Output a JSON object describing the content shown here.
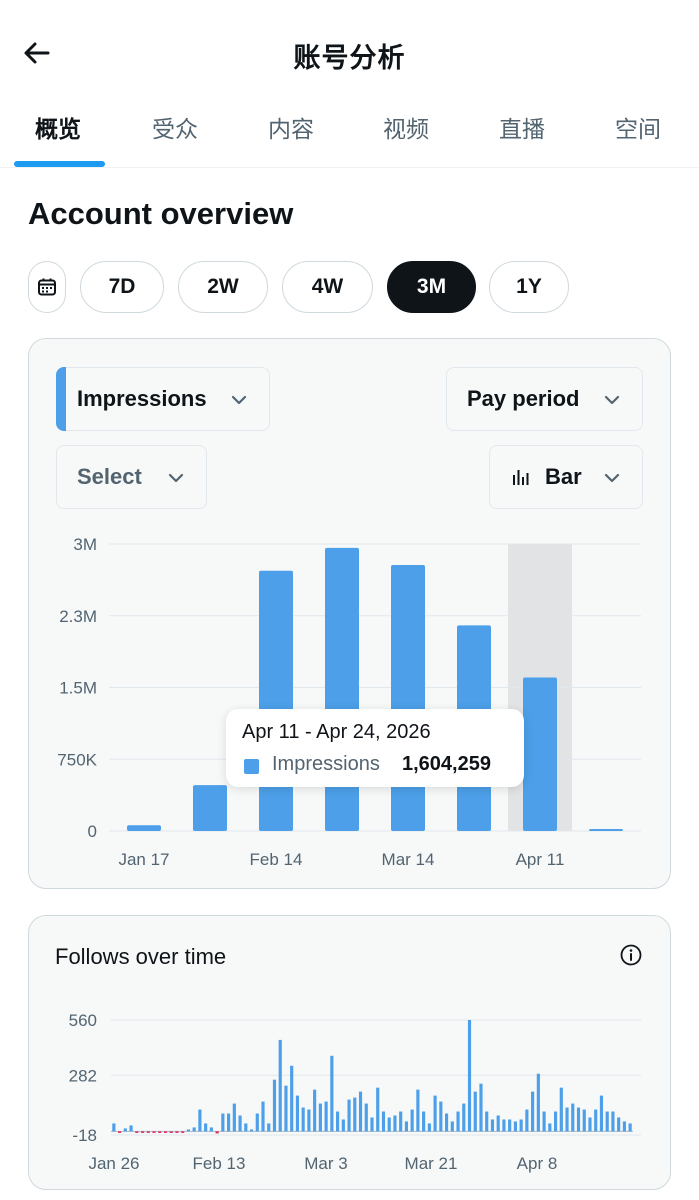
{
  "header": {
    "title": "账号分析"
  },
  "tabs": [
    {
      "label": "概览",
      "active": true
    },
    {
      "label": "受众",
      "active": false
    },
    {
      "label": "内容",
      "active": false
    },
    {
      "label": "视频",
      "active": false
    },
    {
      "label": "直播",
      "active": false
    },
    {
      "label": "空间",
      "active": false
    }
  ],
  "overview": {
    "title": "Account overview",
    "ranges": [
      {
        "label": "7D",
        "selected": false
      },
      {
        "label": "2W",
        "selected": false
      },
      {
        "label": "4W",
        "selected": false
      },
      {
        "label": "3M",
        "selected": true
      },
      {
        "label": "1Y",
        "selected": false
      }
    ],
    "metric_label": "Impressions",
    "period_label": "Pay period",
    "compare_label": "Select",
    "chart_type_label": "Bar"
  },
  "tooltip": {
    "date": "Apr 11 - Apr 24, 2026",
    "label": "Impressions",
    "value": "1,604,259"
  },
  "follows": {
    "title": "Follows over time"
  },
  "colors": {
    "accent": "#1d9bf0",
    "bar": "#4c9fe8",
    "negative": "#e0245e",
    "selected_chip": "#0f1419"
  },
  "icons": [
    "back-arrow-icon",
    "calendar-icon",
    "chevron-down-icon",
    "bar-chart-icon",
    "info-icon"
  ],
  "chart_data": [
    {
      "type": "bar",
      "series": [
        {
          "name": "Impressions",
          "values": [
            60000,
            480000,
            2720000,
            2960000,
            2780000,
            2150000,
            1604259,
            10000
          ]
        }
      ],
      "x_tick_labels": [
        "Jan 17",
        "Feb 14",
        "Mar 14",
        "Apr 11"
      ],
      "y_tick_labels": [
        "0",
        "750K",
        "1.5M",
        "2.3M",
        "3M"
      ],
      "y_ticks": [
        0,
        750000,
        1500000,
        2250000,
        3000000
      ],
      "ylim": [
        0,
        3000000
      ],
      "highlighted_index": 6,
      "grid": true
    },
    {
      "type": "bar",
      "series": [
        {
          "name": "",
          "values": [
            40,
            -5,
            15,
            30,
            -5,
            -5,
            -5,
            -5,
            -5,
            -5,
            -5,
            -5,
            -5,
            10,
            20,
            110,
            40,
            20,
            -10,
            90,
            90,
            140,
            80,
            40,
            10,
            90,
            150,
            40,
            260,
            460,
            230,
            330,
            180,
            120,
            110,
            210,
            140,
            150,
            380,
            100,
            60,
            160,
            170,
            200,
            140,
            70,
            220,
            100,
            70,
            80,
            100,
            50,
            110,
            210,
            100,
            40,
            180,
            150,
            90,
            50,
            100,
            140,
            560,
            200,
            240,
            100,
            60,
            80,
            60,
            60,
            50,
            60,
            110,
            200,
            290,
            100,
            40,
            100,
            220,
            120,
            140,
            120,
            110,
            70,
            110,
            180,
            100,
            100,
            70,
            50,
            40
          ]
        }
      ],
      "x_tick_labels": [
        "Jan 26",
        "Feb 13",
        "Mar 3",
        "Mar 21",
        "Apr 8"
      ],
      "y_tick_labels": [
        "-18",
        "282",
        "560"
      ],
      "y_ticks": [
        -18,
        282,
        560
      ],
      "ylim": [
        -18,
        560
      ],
      "grid": true
    }
  ]
}
